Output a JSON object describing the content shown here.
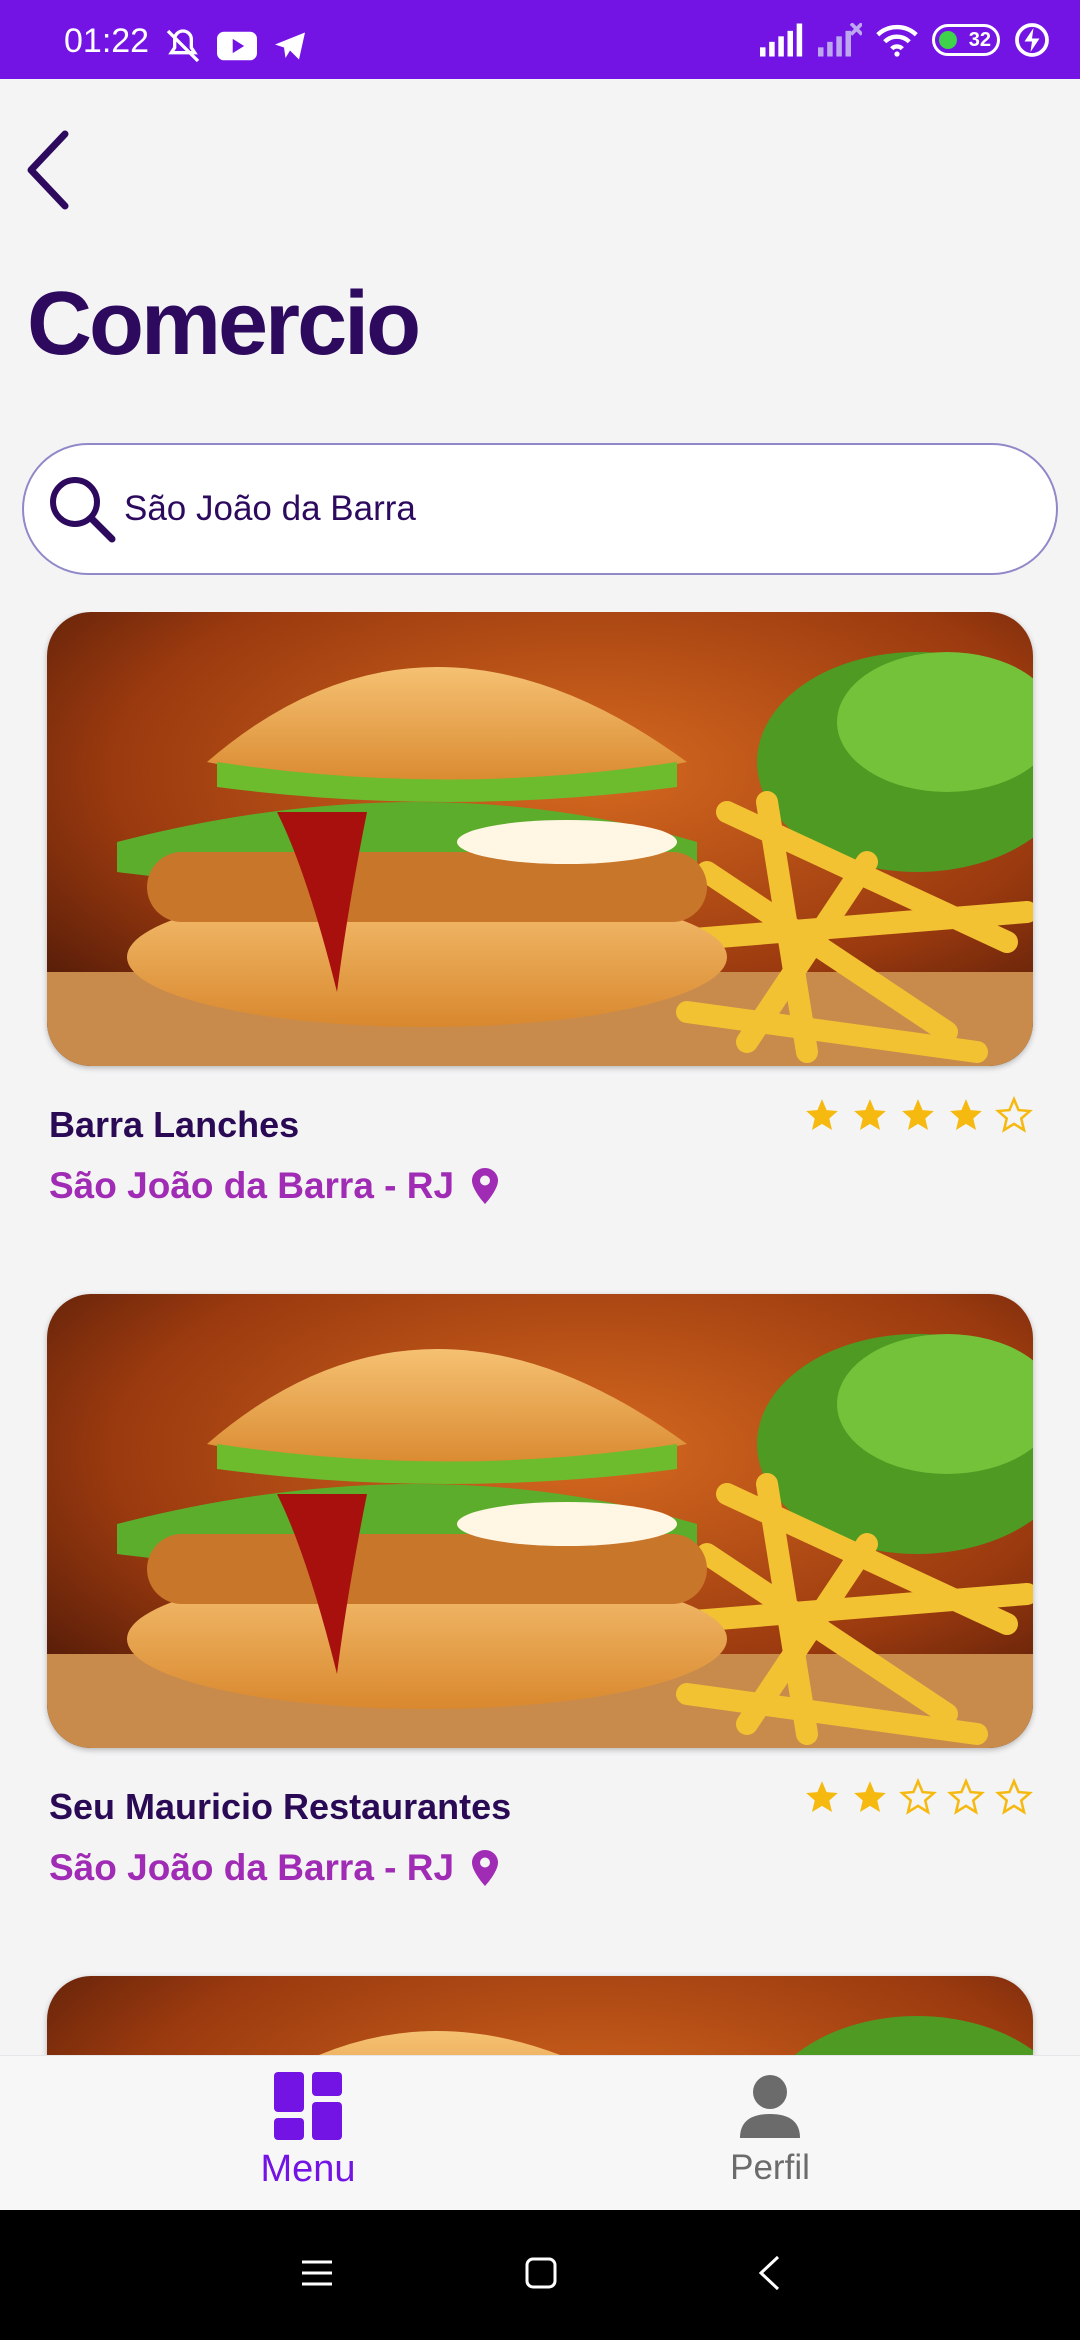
{
  "status_bar": {
    "time": "01:22",
    "battery": "32",
    "icons": [
      "mute-icon",
      "youtube-icon",
      "telegram-icon",
      "signal-icon",
      "signal-off-icon",
      "wifi-icon",
      "battery-icon",
      "charging-icon"
    ]
  },
  "header": {
    "back_icon": "chevron-left-icon",
    "title": "Comercio"
  },
  "search": {
    "value": "São João da Barra",
    "icon": "search-icon"
  },
  "cards": [
    {
      "name": "Barra Lanches",
      "location": "São João da Barra - RJ",
      "rating": 4,
      "max_rating": 5
    },
    {
      "name": "Seu Mauricio Restaurantes",
      "location": "São João da Barra - RJ",
      "rating": 2,
      "max_rating": 5
    },
    {
      "name": "",
      "location": "",
      "rating": 0,
      "max_rating": 5
    }
  ],
  "bottom_nav": {
    "items": [
      {
        "label": "Menu",
        "icon": "dashboard-icon",
        "active": true
      },
      {
        "label": "Perfil",
        "icon": "person-icon",
        "active": false
      }
    ]
  },
  "colors": {
    "primary": "#7314e5",
    "title": "#2d0a5e",
    "location": "#a02bb4",
    "star": "#f5b90f",
    "inactive": "#6b6b6b"
  }
}
